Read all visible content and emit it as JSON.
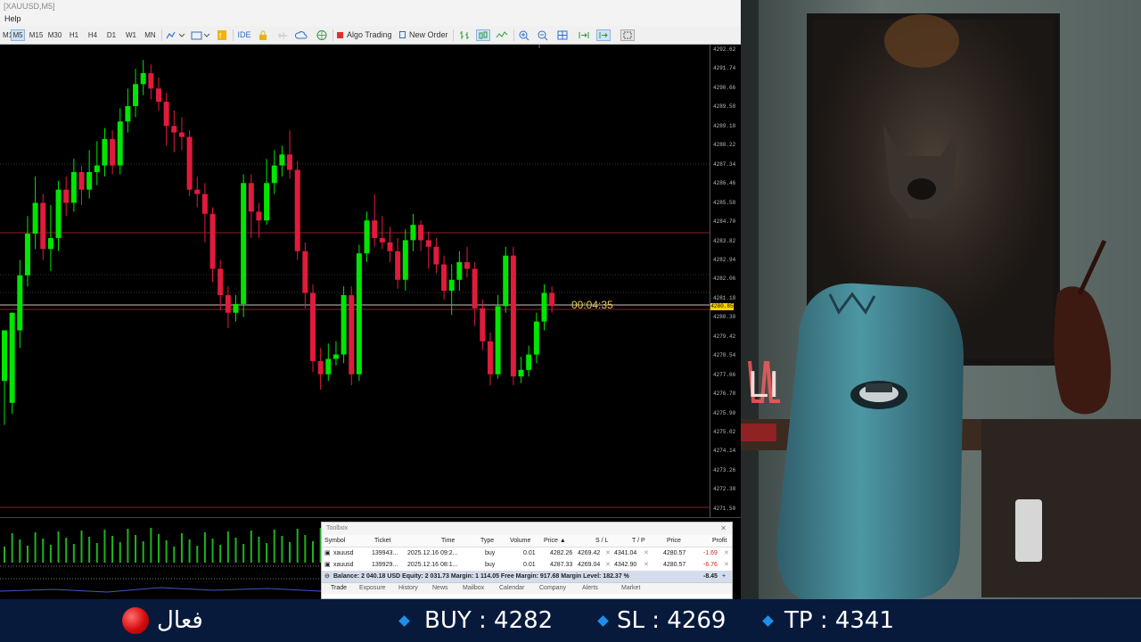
{
  "window": {
    "title": "[XAUUSD,M5]"
  },
  "menu": {
    "help": "Help"
  },
  "toolbar": {
    "timeframes": [
      "M1",
      "M5",
      "M15",
      "M30",
      "H1",
      "H4",
      "D1",
      "W1",
      "MN"
    ],
    "active_timeframe": "M5",
    "ide_label": "IDE",
    "algo_trading_label": "Algo Trading",
    "new_order_label": "New Order"
  },
  "chart": {
    "symbol": "XAUUSD",
    "timeframe": "M5",
    "countdown": "00:04:35",
    "current_price": "4280.85",
    "price_labels": [
      "4292.62",
      "4291.74",
      "4290.66",
      "4289.58",
      "4289.10",
      "4288.22",
      "4287.34",
      "4286.46",
      "4285.58",
      "4284.70",
      "4283.82",
      "4282.94",
      "4282.06",
      "4281.18",
      "4280.30",
      "4279.42",
      "4278.54",
      "4277.66",
      "4276.78",
      "4275.90",
      "4275.02",
      "4274.14",
      "4273.26",
      "4272.38",
      "4271.50"
    ],
    "colors": {
      "bull": "#00e600",
      "bear": "#e01b3c",
      "background": "#000000"
    }
  },
  "chart_data": {
    "type": "candlestick",
    "ylim": [
      4271.3,
      4292.8
    ],
    "candles": [
      [
        4277.5,
        4279.8,
        4275.8,
        4275.5
      ],
      [
        4276.5,
        4280.6,
        4279.8,
        4276.0
      ],
      [
        4279.8,
        4282.3,
        4283.0,
        4279.0
      ],
      [
        4282.3,
        4284.2,
        4285.0,
        4281.8
      ],
      [
        4284.2,
        4285.6,
        4286.8,
        4283.5
      ],
      [
        4285.6,
        4283.5,
        4286.0,
        4283.0
      ],
      [
        4283.5,
        4284.0,
        4285.5,
        4282.5
      ],
      [
        4284.0,
        4286.2,
        4286.6,
        4283.4
      ],
      [
        4286.2,
        4285.6,
        4286.8,
        4285.0
      ],
      [
        4285.6,
        4287.0,
        4287.6,
        4285.2
      ],
      [
        4287.0,
        4286.2,
        4287.3,
        4285.5
      ],
      [
        4286.2,
        4287.0,
        4288.0,
        4285.8
      ],
      [
        4287.0,
        4287.3,
        4288.4,
        4286.4
      ],
      [
        4287.3,
        4288.5,
        4289.0,
        4286.8
      ],
      [
        4288.5,
        4287.3,
        4288.9,
        4286.9
      ],
      [
        4287.3,
        4289.3,
        4289.9,
        4286.9
      ],
      [
        4289.3,
        4290.0,
        4290.8,
        4288.8
      ],
      [
        4290.0,
        4291.0,
        4291.7,
        4289.5
      ],
      [
        4291.0,
        4291.5,
        4292.1,
        4290.5
      ],
      [
        4291.5,
        4290.8,
        4291.9,
        4290.3
      ],
      [
        4290.8,
        4290.2,
        4291.3,
        4289.8
      ],
      [
        4290.2,
        4289.1,
        4290.6,
        4288.2
      ],
      [
        4289.1,
        4288.8,
        4289.8,
        4287.9
      ],
      [
        4288.8,
        4288.6,
        4289.5,
        4288.0
      ],
      [
        4288.6,
        4286.2,
        4288.9,
        4285.9
      ],
      [
        4286.2,
        4286.0,
        4286.8,
        4285.4
      ],
      [
        4286.0,
        4285.1,
        4286.5,
        4283.8
      ],
      [
        4285.1,
        4282.6,
        4285.4,
        4282.0
      ],
      [
        4282.6,
        4281.4,
        4283.0,
        4280.7
      ],
      [
        4281.4,
        4280.6,
        4281.8,
        4279.9
      ],
      [
        4280.6,
        4281.0,
        4281.4,
        4280.2
      ],
      [
        4281.0,
        4286.5,
        4286.9,
        4280.4
      ],
      [
        4286.5,
        4285.2,
        4286.9,
        4284.0
      ],
      [
        4285.2,
        4284.8,
        4285.6,
        4284.0
      ],
      [
        4284.8,
        4286.5,
        4287.6,
        4284.6
      ],
      [
        4286.5,
        4287.3,
        4288.0,
        4286.0
      ],
      [
        4287.3,
        4287.8,
        4288.2,
        4286.8
      ],
      [
        4287.8,
        4287.1,
        4288.9,
        4286.7
      ],
      [
        4287.1,
        4283.4,
        4287.5,
        4283.0
      ],
      [
        4283.4,
        4281.5,
        4283.8,
        4280.8
      ],
      [
        4281.5,
        4278.4,
        4281.9,
        4277.9
      ],
      [
        4278.4,
        4277.8,
        4279.0,
        4277.1
      ],
      [
        4277.8,
        4278.5,
        4279.2,
        4277.5
      ],
      [
        4278.5,
        4278.7,
        4279.3,
        4278.2
      ],
      [
        4278.7,
        4281.4,
        4281.8,
        4278.3
      ],
      [
        4281.4,
        4277.8,
        4281.8,
        4277.3
      ],
      [
        4277.8,
        4283.3,
        4283.7,
        4277.5
      ],
      [
        4283.3,
        4284.8,
        4285.2,
        4282.9
      ],
      [
        4284.8,
        4284.0,
        4286.0,
        4283.6
      ],
      [
        4284.0,
        4283.8,
        4285.0,
        4283.5
      ],
      [
        4283.8,
        4283.4,
        4284.5,
        4282.9
      ],
      [
        4283.4,
        4282.1,
        4284.0,
        4281.7
      ],
      [
        4282.1,
        4283.9,
        4284.4,
        4281.6
      ],
      [
        4283.9,
        4284.6,
        4285.1,
        4283.4
      ],
      [
        4284.6,
        4283.9,
        4284.8,
        4283.4
      ],
      [
        4283.9,
        4283.6,
        4284.3,
        4282.6
      ],
      [
        4283.6,
        4282.8,
        4284.0,
        4282.4
      ],
      [
        4282.8,
        4281.6,
        4283.2,
        4281.2
      ],
      [
        4281.6,
        4282.1,
        4282.8,
        4280.5
      ],
      [
        4282.1,
        4282.9,
        4283.4,
        4281.6
      ],
      [
        4282.9,
        4282.6,
        4283.6,
        4282.2
      ],
      [
        4282.6,
        4280.8,
        4282.9,
        4280.0
      ],
      [
        4280.8,
        4279.3,
        4281.2,
        4278.9
      ],
      [
        4279.3,
        4277.8,
        4279.7,
        4277.3
      ],
      [
        4277.8,
        4280.9,
        4281.4,
        4277.6
      ],
      [
        4280.9,
        4283.2,
        4283.6,
        4280.6
      ],
      [
        4283.2,
        4277.7,
        4283.6,
        4277.3
      ],
      [
        4277.7,
        4278.0,
        4278.6,
        4277.4
      ],
      [
        4278.0,
        4278.7,
        4279.1,
        4277.7
      ],
      [
        4278.7,
        4280.2,
        4280.6,
        4278.3
      ],
      [
        4280.2,
        4281.5,
        4281.9,
        4279.8
      ],
      [
        4281.5,
        4280.9,
        4281.8,
        4280.6
      ]
    ]
  },
  "toolbox": {
    "title": "Toolbox",
    "columns": [
      "Symbol",
      "Ticket",
      "Time",
      "Type",
      "Volume",
      "Price",
      "S / L",
      "T / P",
      "Price",
      "Profit"
    ],
    "rows": [
      [
        "xauusd",
        "139943...",
        "2025.12.16 09:2...",
        "buy",
        "0.01",
        "4282.26",
        "4269.42",
        "4341.04",
        "4280.57",
        "-1.69"
      ],
      [
        "xauusd",
        "139929...",
        "2025.12.16 08:1...",
        "buy",
        "0.01",
        "4287.33",
        "4269.04",
        "4342.90",
        "4280.57",
        "-6.76"
      ]
    ],
    "balance_line": "Balance: 2 040.18 USD  Equity: 2 031.73  Margin: 1 114.05  Free Margin: 917.68  Margin Level: 182.37 %",
    "total_profit": "-8.45",
    "tabs": [
      "Trade",
      "Exposure",
      "History",
      "News",
      "Mailbox",
      "Calendar",
      "Company",
      "Alerts",
      "Market"
    ]
  },
  "ticker": {
    "status_label": "فعال",
    "buy_label": "BUY : 4282",
    "sl_label": "SL : 4269",
    "tp_label": "TP :  4341",
    "colors": {
      "background": "#071a3c",
      "diamond": "#1e8fe8",
      "status_dot": "#d40d0d"
    }
  },
  "webcam": {
    "neon_text": "LI"
  }
}
